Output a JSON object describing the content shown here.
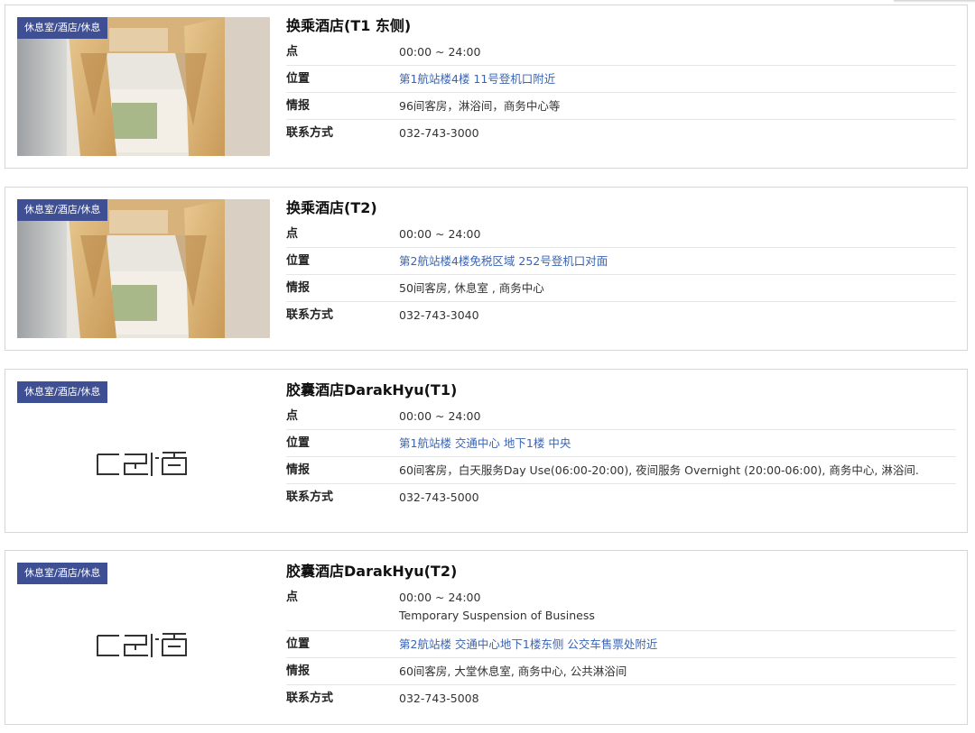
{
  "labels": {
    "hours": "点",
    "location": "位置",
    "info": "情报",
    "contact": "联系方式"
  },
  "colors": {
    "badge_bg": "#3f4f94",
    "link": "#3a64b4",
    "border": "#d6d6d6"
  },
  "hotels": [
    {
      "badge": "休息室/酒店/休息",
      "title": "换乘酒店(T1 东侧)",
      "media": "hotel-photo",
      "hours": "00:00 ~ 24:00",
      "hours_note": "",
      "location": "第1航站楼4楼 11号登机口附近",
      "info": "96间客房，淋浴间，商务中心等",
      "contact": "032-743-3000"
    },
    {
      "badge": "休息室/酒店/休息",
      "title": "换乘酒店(T2)",
      "media": "hotel-photo",
      "hours": "00:00 ~ 24:00",
      "hours_note": "",
      "location": "第2航站楼4楼免税区域 252号登机口对面",
      "info": "50间客房, 休息室 , 商务中心",
      "contact": "032-743-3040"
    },
    {
      "badge": "休息室/酒店/休息",
      "title": "胶囊酒店DarakHyu(T1)",
      "media": "darakhyu-logo",
      "hours": "00:00 ~ 24:00",
      "hours_note": "",
      "location": "第1航站楼 交通中心 地下1楼 中央",
      "info": "60间客房，白天服务Day Use(06:00-20:00), 夜间服务 Overnight (20:00-06:00), 商务中心, 淋浴间.",
      "contact": "032-743-5000"
    },
    {
      "badge": "休息室/酒店/休息",
      "title": "胶囊酒店DarakHyu(T2)",
      "media": "darakhyu-logo",
      "hours": "00:00 ~ 24:00",
      "hours_note": "Temporary Suspension of Business",
      "location": "第2航站楼 交通中心地下1楼东侧 公交车售票处附近",
      "info": "60间客房, 大堂休息室, 商务中心, 公共淋浴间",
      "contact": "032-743-5008"
    }
  ]
}
